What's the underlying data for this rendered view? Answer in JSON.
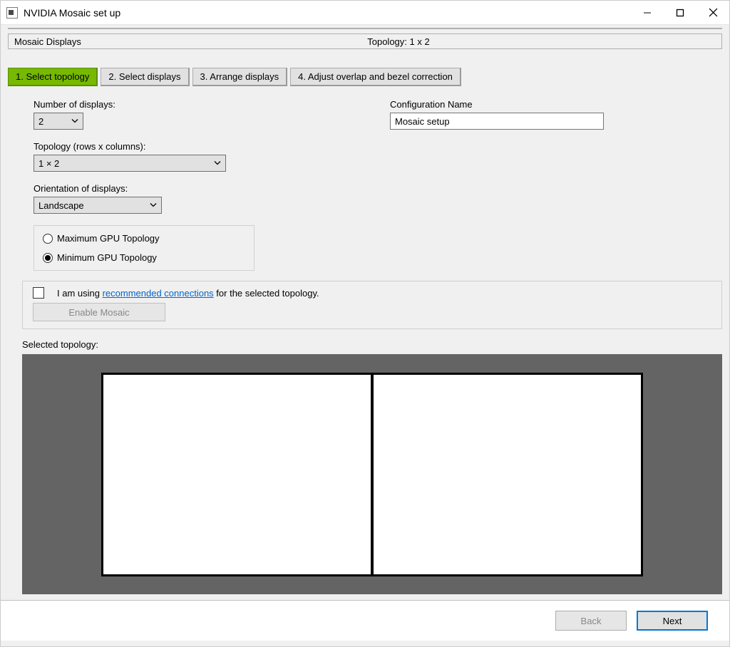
{
  "window": {
    "title": "NVIDIA Mosaic set up"
  },
  "status": {
    "left": "Mosaic Displays",
    "right": "Topology: 1 x 2"
  },
  "tabs": [
    {
      "label": "1. Select topology"
    },
    {
      "label": "2. Select displays"
    },
    {
      "label": "3. Arrange displays"
    },
    {
      "label": "4. Adjust overlap and bezel correction"
    }
  ],
  "form": {
    "num_displays_label": "Number of displays:",
    "num_displays_value": "2",
    "topology_label": "Topology (rows x columns):",
    "topology_value": "1 × 2",
    "orientation_label": "Orientation of displays:",
    "orientation_value": "Landscape",
    "radio_max": "Maximum GPU Topology",
    "radio_min": "Minimum GPU Topology",
    "config_name_label": "Configuration Name",
    "config_name_value": "Mosaic setup",
    "check_prefix": "I am using ",
    "check_link": "recommended connections",
    "check_suffix": " for the selected topology.",
    "enable_btn": "Enable Mosaic",
    "selected_topology_label": "Selected topology:"
  },
  "footer": {
    "back": "Back",
    "next": "Next"
  }
}
